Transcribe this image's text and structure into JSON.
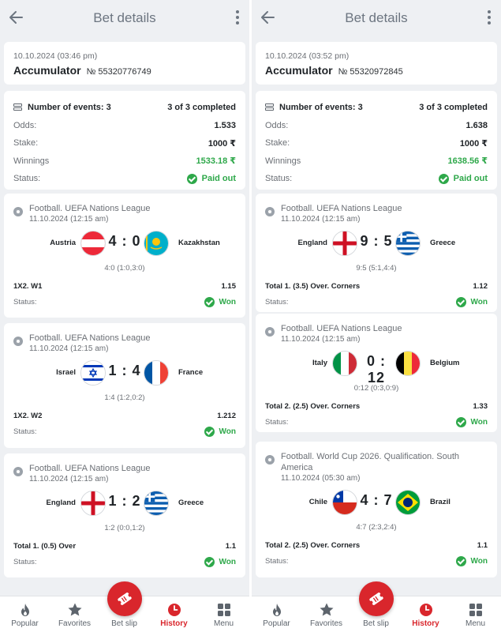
{
  "app": {
    "title": "Bet details"
  },
  "colors": {
    "accent": "#d9262c",
    "success": "#2ea84a",
    "background": "#eef0f3"
  },
  "labels": {
    "odds": "Odds:",
    "stake": "Stake:",
    "winnings": "Winnings",
    "status": "Status:",
    "paid_out": "Paid out",
    "won": "Won"
  },
  "nav": [
    {
      "label": "Popular",
      "icon": "fire-icon"
    },
    {
      "label": "Favorites",
      "icon": "star-icon"
    },
    {
      "label": "Bet slip",
      "icon": "ticket-icon"
    },
    {
      "label": "History",
      "icon": "clock-icon",
      "active": true
    },
    {
      "label": "Menu",
      "icon": "grid-icon"
    }
  ],
  "bets": [
    {
      "datetime": "10.10.2024 (03:46 pm)",
      "type": "Accumulator",
      "number": "№ 55320776749",
      "events_label": "Number of events: 3",
      "completed": "3 of 3 completed",
      "odds": "1.533",
      "stake": "1000 ₹",
      "winnings": "1533.18 ₹",
      "events": [
        {
          "league": "Football. UEFA Nations League",
          "date": "11.10.2024 (12:15 am)",
          "home": "Austria",
          "away": "Kazakhstan",
          "score": "4 : 0",
          "detail": "4:0 (1:0,3:0)",
          "market": "1X2. W1",
          "coef": "1.15",
          "home_flag": "austria",
          "away_flag": "kazakhstan"
        },
        {
          "league": "Football. UEFA Nations League",
          "date": "11.10.2024 (12:15 am)",
          "home": "Israel",
          "away": "France",
          "score": "1 : 4",
          "detail": "1:4 (1:2,0:2)",
          "market": "1X2. W2",
          "coef": "1.212",
          "home_flag": "israel",
          "away_flag": "france"
        },
        {
          "league": "Football. UEFA Nations League",
          "date": "11.10.2024 (12:15 am)",
          "home": "England",
          "away": "Greece",
          "score": "1 : 2",
          "detail": "1:2 (0:0,1:2)",
          "market": "Total 1. (0.5) Over",
          "coef": "1.1",
          "home_flag": "england",
          "away_flag": "greece"
        }
      ]
    },
    {
      "datetime": "10.10.2024 (03:52 pm)",
      "type": "Accumulator",
      "number": "№ 55320972845",
      "events_label": "Number of events: 3",
      "completed": "3 of 3 completed",
      "odds": "1.638",
      "stake": "1000 ₹",
      "winnings": "1638.56 ₹",
      "events": [
        {
          "league": "Football. UEFA Nations League",
          "date": "11.10.2024 (12:15 am)",
          "home": "England",
          "away": "Greece",
          "score": "9 : 5",
          "detail": "9:5 (5:1,4:4)",
          "market": "Total 1. (3.5) Over. Corners",
          "coef": "1.12",
          "home_flag": "england",
          "away_flag": "greece"
        },
        {
          "league": "Football. UEFA Nations League",
          "date": "11.10.2024 (12:15 am)",
          "home": "Italy",
          "away": "Belgium",
          "score": "0 : 12",
          "detail": "0:12 (0:3,0:9)",
          "market": "Total 2. (2.5) Over. Corners",
          "coef": "1.33",
          "home_flag": "italy",
          "away_flag": "belgium"
        },
        {
          "league": "Football. World Cup 2026. Qualification. South America",
          "date": "11.10.2024 (05:30 am)",
          "home": "Chile",
          "away": "Brazil",
          "score": "4 : 7",
          "detail": "4:7 (2:3,2:4)",
          "market": "Total 2. (2.5) Over. Corners",
          "coef": "1.1",
          "home_flag": "chile",
          "away_flag": "brazil"
        }
      ]
    }
  ]
}
